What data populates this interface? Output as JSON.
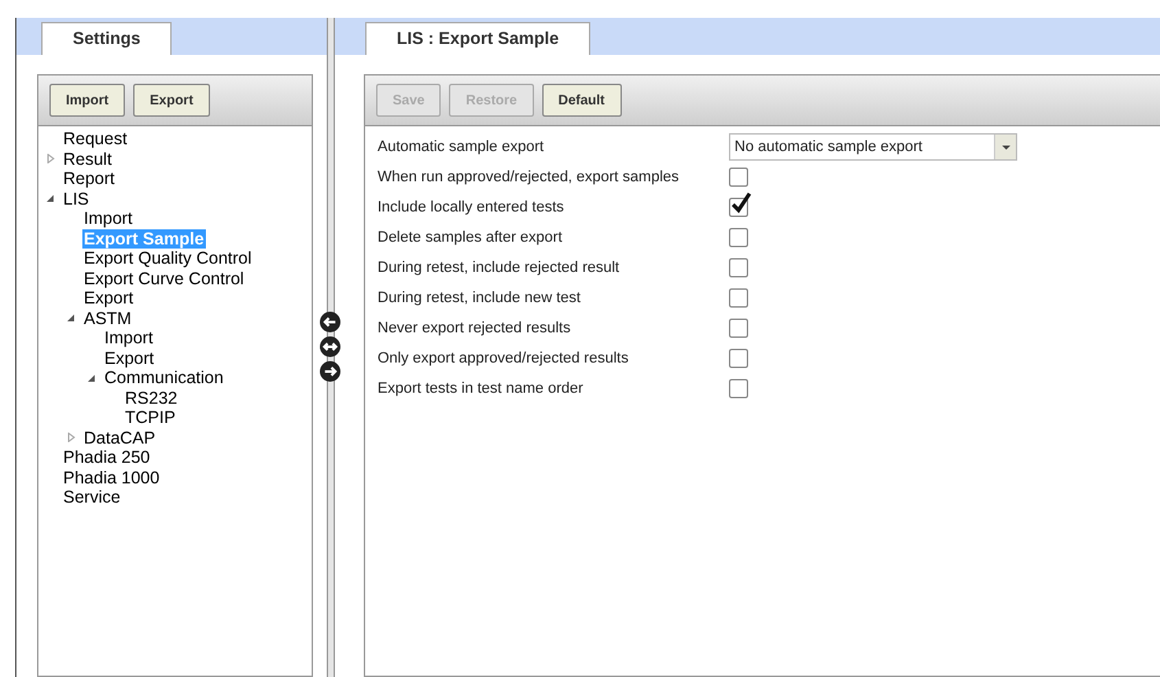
{
  "left_tab": {
    "label": "Settings",
    "selected": true
  },
  "left_toolbar": [
    {
      "label": "Import",
      "disabled": false
    },
    {
      "label": "Export",
      "disabled": false
    }
  ],
  "tree": [
    {
      "label": "Request",
      "selected": false
    },
    {
      "label": "Result",
      "selected": false,
      "expanded": false
    },
    {
      "label": "Report",
      "selected": false
    },
    {
      "label": "LIS",
      "selected": false,
      "expanded": true,
      "children": [
        {
          "label": "Import",
          "selected": false
        },
        {
          "label": "Export Sample",
          "selected": true
        },
        {
          "label": "Export Quality Control",
          "selected": false
        },
        {
          "label": "Export Curve Control",
          "selected": false
        },
        {
          "label": "Export",
          "selected": false
        },
        {
          "label": "ASTM",
          "selected": false,
          "expanded": true,
          "children": [
            {
              "label": "Import",
              "selected": false
            },
            {
              "label": "Export",
              "selected": false
            },
            {
              "label": "Communication",
              "selected": false,
              "expanded": true,
              "children": [
                {
                  "label": "RS232",
                  "selected": false
                },
                {
                  "label": "TCPIP",
                  "selected": false
                }
              ]
            }
          ]
        },
        {
          "label": "DataCAP",
          "selected": false,
          "expanded": false
        }
      ]
    },
    {
      "label": "Phadia 250",
      "selected": false
    },
    {
      "label": "Phadia 1000",
      "selected": false
    },
    {
      "label": "Service",
      "selected": false
    }
  ],
  "right_tab": {
    "label": "LIS : Export Sample",
    "selected": true
  },
  "right_toolbar": [
    {
      "label": "Save",
      "disabled": true
    },
    {
      "label": "Restore",
      "disabled": true
    },
    {
      "label": "Default",
      "disabled": false
    }
  ],
  "settings": [
    {
      "kind": "dropdown",
      "label": "Automatic sample export",
      "value": "No automatic sample export"
    },
    {
      "kind": "checkbox",
      "label": "When run approved/rejected, export samples",
      "checked": false
    },
    {
      "kind": "checkbox",
      "label": "Include locally entered tests",
      "checked": true
    },
    {
      "kind": "checkbox",
      "label": "Delete samples after export",
      "checked": false
    },
    {
      "kind": "checkbox",
      "label": "During retest, include rejected result",
      "checked": false
    },
    {
      "kind": "checkbox",
      "label": "During retest, include new test",
      "checked": false
    },
    {
      "kind": "checkbox",
      "label": "Never export rejected results",
      "checked": false
    },
    {
      "kind": "checkbox",
      "label": "Only export approved/rejected results",
      "checked": false
    },
    {
      "kind": "checkbox",
      "label": "Export tests in test name order",
      "checked": false
    }
  ]
}
